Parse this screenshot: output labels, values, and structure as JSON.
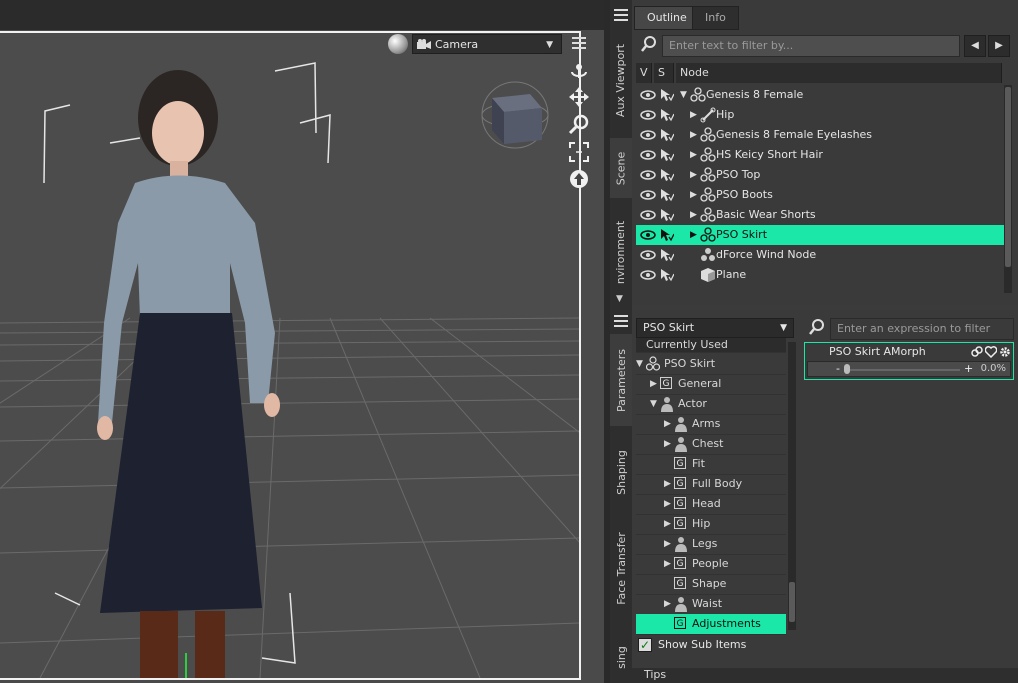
{
  "viewport": {
    "camera_label": "Camera",
    "camera_icon": "movie-camera-icon",
    "nav_tools": [
      "orbit-icon",
      "pan-icon",
      "zoom-icon",
      "frame-icon",
      "bow-icon"
    ]
  },
  "dock_tabs": {
    "aux_viewport": "Aux Viewport",
    "scene": "Scene",
    "environment": "nvironment",
    "parameters": "Parameters",
    "shaping": "Shaping",
    "face_transfer": "Face Transfer",
    "posing": "sing"
  },
  "outline_panel": {
    "tabs": [
      "Outline",
      "Info"
    ],
    "filter_placeholder": "Enter text to filter by...",
    "columns": {
      "v": "V",
      "s": "S",
      "node": "Node"
    },
    "rows": [
      {
        "label": "Genesis 8 Female",
        "icon": "figure-icon",
        "expanded": true,
        "selected": false
      },
      {
        "label": "Hip",
        "icon": "bone-icon",
        "selected": false
      },
      {
        "label": "Genesis 8 Female Eyelashes",
        "icon": "figure-icon",
        "selected": false
      },
      {
        "label": "HS Keicy Short Hair",
        "icon": "figure-icon",
        "selected": false
      },
      {
        "label": "PSO Top",
        "icon": "figure-icon",
        "selected": false
      },
      {
        "label": "PSO Boots",
        "icon": "figure-icon",
        "selected": false
      },
      {
        "label": "Basic Wear Shorts",
        "icon": "figure-icon",
        "selected": false
      },
      {
        "label": "PSO Skirt",
        "icon": "figure-icon",
        "selected": true
      },
      {
        "label": "dForce Wind Node",
        "icon": "wind-node-icon",
        "selected": false
      },
      {
        "label": "Plane",
        "icon": "cube-icon",
        "selected": false
      }
    ]
  },
  "parameters_panel": {
    "node_select": "PSO Skirt",
    "filter_placeholder": "Enter an expression to filter by...",
    "tree": [
      {
        "label": "Currently Used",
        "type": "header"
      },
      {
        "label": "PSO Skirt",
        "type": "figure",
        "expanded": true
      },
      {
        "label": "General",
        "type": "group"
      },
      {
        "label": "Actor",
        "type": "figure",
        "expanded": true
      },
      {
        "label": "Arms",
        "type": "figure"
      },
      {
        "label": "Chest",
        "type": "figure"
      },
      {
        "label": "Fit",
        "type": "group"
      },
      {
        "label": "Full Body",
        "type": "group"
      },
      {
        "label": "Head",
        "type": "group"
      },
      {
        "label": "Hip",
        "type": "group"
      },
      {
        "label": "Legs",
        "type": "figure"
      },
      {
        "label": "People",
        "type": "group"
      },
      {
        "label": "Shape",
        "type": "group"
      },
      {
        "label": "Waist",
        "type": "figure"
      },
      {
        "label": "Adjustments",
        "type": "group",
        "selected": true
      }
    ],
    "show_sub_items_label": "Show Sub Items",
    "show_sub_items_checked": true,
    "morph": {
      "name": "PSO Skirt AMorph",
      "value": "0.0%"
    }
  },
  "tips_label": "Tips",
  "colors": {
    "selection": "#1be8a8",
    "panel": "#3a3a3a"
  }
}
